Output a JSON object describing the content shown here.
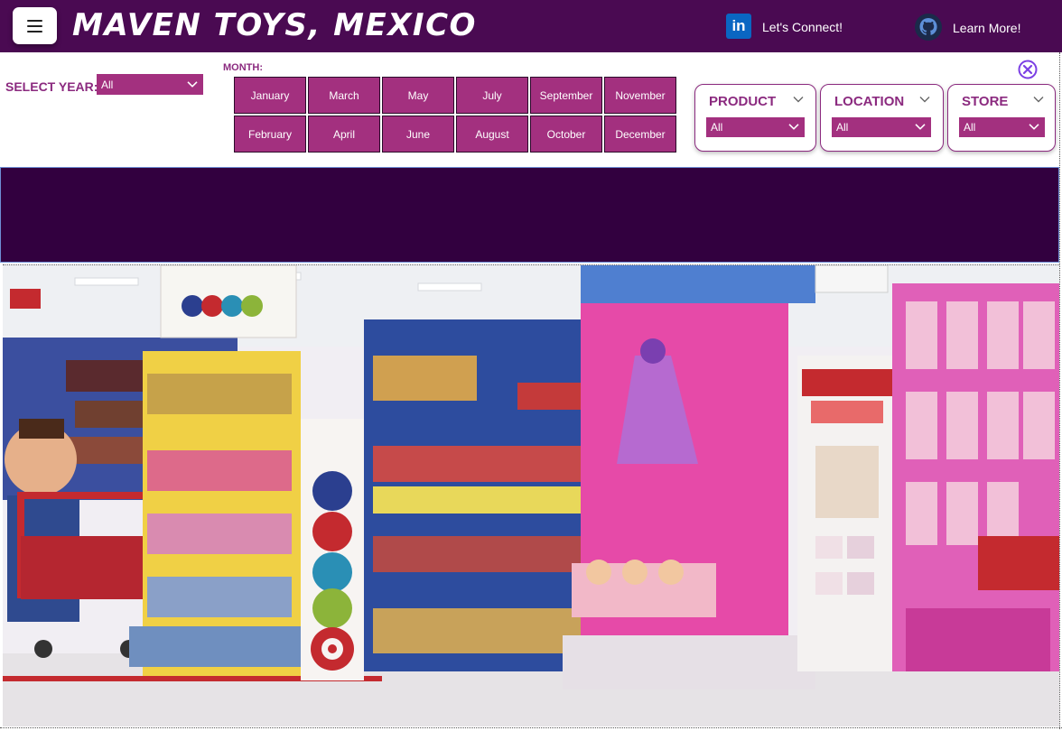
{
  "header": {
    "title": "MAVEN TOYS, MEXICO",
    "links": [
      {
        "label": "Let's Connect!",
        "icon": "linkedin-icon",
        "icon_text": "in"
      },
      {
        "label": "Learn More!",
        "icon": "github-icon"
      }
    ]
  },
  "filters": {
    "year": {
      "label": "SELECT YEAR:",
      "value": "All"
    },
    "month": {
      "label": "MONTH:",
      "months": [
        "January",
        "March",
        "May",
        "July",
        "September",
        "November",
        "February",
        "April",
        "June",
        "August",
        "October",
        "December"
      ]
    },
    "slicers": [
      {
        "title": "PRODUCT",
        "value": "All"
      },
      {
        "title": "LOCATION",
        "value": "All"
      },
      {
        "title": "STORE",
        "value": "All"
      }
    ]
  },
  "colors": {
    "header_bg": "#4a0a52",
    "accent": "#a3307f",
    "label": "#8b2a7f",
    "banner_bg": "#32003f"
  }
}
